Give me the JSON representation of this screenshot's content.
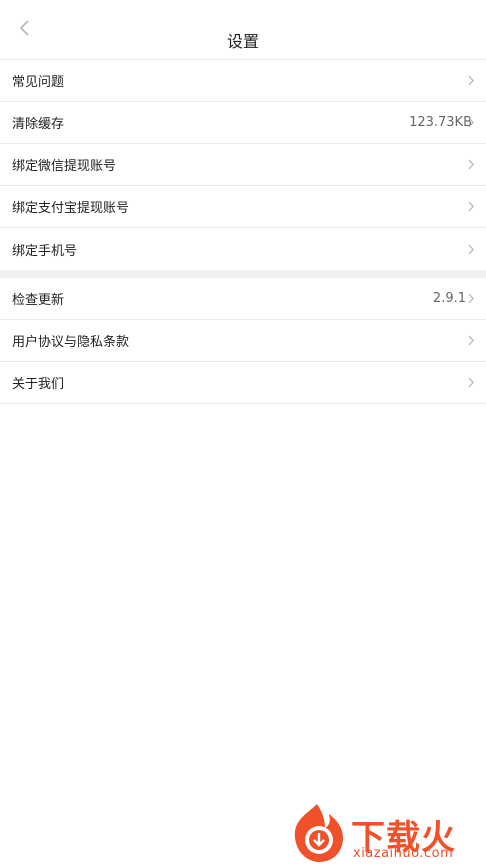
{
  "header": {
    "title": "设置",
    "back_icon": "chevron-left-icon"
  },
  "colors": {
    "background": "#ffffff",
    "divider": "#ececec",
    "section_gap": "#f1f1f1",
    "text_primary": "#222222",
    "text_secondary": "#666666",
    "chevron": "#b5b5b5",
    "watermark": "#f0502a"
  },
  "section1": {
    "items": [
      {
        "label": "常见问题",
        "value": "",
        "icon": "chevron-right-icon"
      },
      {
        "label": "清除缓存",
        "value": "123.73KB",
        "icon": ""
      },
      {
        "label": "绑定微信提现账号",
        "value": "",
        "icon": "chevron-right-icon"
      },
      {
        "label": "绑定支付宝提现账号",
        "value": "",
        "icon": "chevron-right-icon"
      },
      {
        "label": "绑定手机号",
        "value": "",
        "icon": "chevron-right-icon"
      }
    ]
  },
  "section2": {
    "items": [
      {
        "label": "检查更新",
        "value": "2.9.1",
        "icon": "chevron-right-icon"
      },
      {
        "label": "用户协议与隐私条款",
        "value": "",
        "icon": "chevron-right-icon"
      },
      {
        "label": "关于我们",
        "value": "",
        "icon": "chevron-right-icon"
      }
    ]
  },
  "watermark": {
    "name": "下载火",
    "url": "xiazaihuo.com",
    "icon": "flame-logo-icon"
  }
}
